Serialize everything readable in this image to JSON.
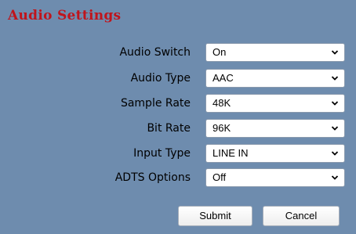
{
  "title": "Audio Settings",
  "colors": {
    "panel_background": "#6e8cae",
    "title_text": "#c0141c"
  },
  "fields": [
    {
      "label": "Audio Switch",
      "value": "On"
    },
    {
      "label": "Audio Type",
      "value": "AAC"
    },
    {
      "label": "Sample Rate",
      "value": "48K"
    },
    {
      "label": "Bit Rate",
      "value": "96K"
    },
    {
      "label": "Input Type",
      "value": "LINE IN"
    },
    {
      "label": "ADTS Options",
      "value": "Off"
    }
  ],
  "buttons": {
    "submit": "Submit",
    "cancel": "Cancel"
  }
}
